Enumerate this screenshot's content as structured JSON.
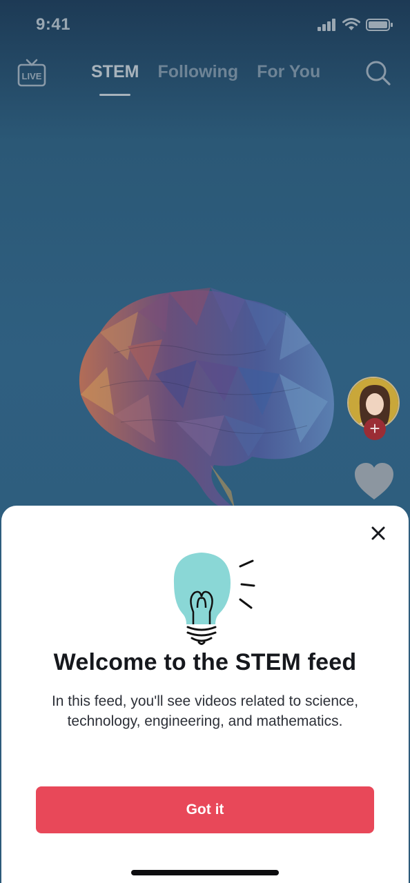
{
  "status_bar": {
    "time": "9:41",
    "icons": [
      "signal-icon",
      "wifi-icon",
      "battery-icon"
    ]
  },
  "top_nav": {
    "live_label": "LIVE",
    "tabs": [
      {
        "label": "STEM",
        "active": true
      },
      {
        "label": "Following",
        "active": false
      },
      {
        "label": "For You",
        "active": false
      }
    ],
    "search_icon": "search-icon"
  },
  "side_actions": {
    "follow_symbol": "+",
    "like_icon": "heart-icon"
  },
  "sheet": {
    "close_icon": "close-icon",
    "illustration": "lightbulb-icon",
    "title": "Welcome to the STEM feed",
    "body": "In this feed, you'll see videos related to science, technology, engineering, and mathematics.",
    "button_label": "Got it"
  },
  "colors": {
    "accent": "#e84859",
    "bulb": "#8ad7d6",
    "feed_bg": "#2d5a7a"
  }
}
